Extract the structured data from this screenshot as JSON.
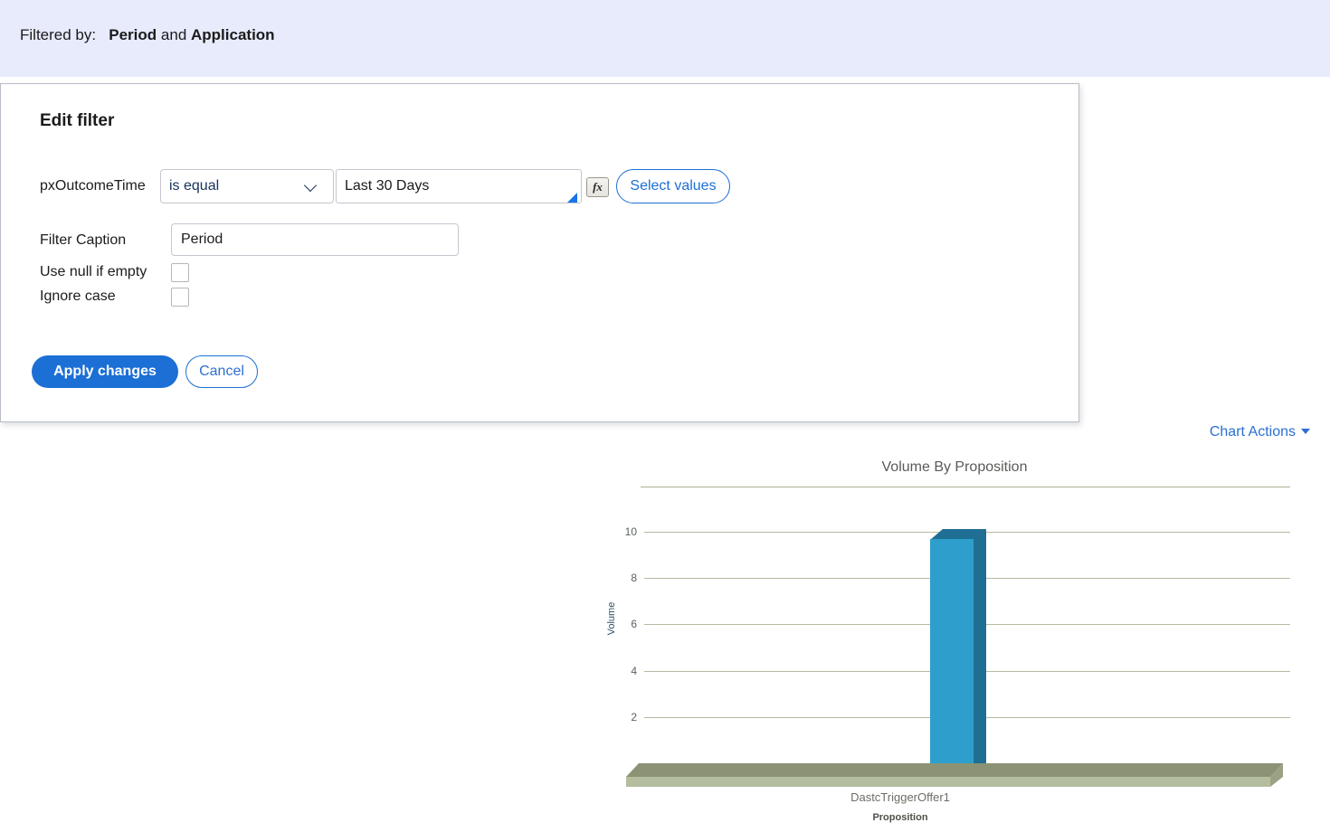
{
  "banner": {
    "prefix": "Filtered by:",
    "filter_one": "Period",
    "conjunction": "and",
    "filter_two": "Application"
  },
  "panel": {
    "title": "Edit filter",
    "property_label": "pxOutcomeTime",
    "operator_value": "is equal",
    "operator_options": [
      "is equal"
    ],
    "value_text": "Last 30 Days",
    "fx_label": "fx",
    "select_values_label": "Select values",
    "caption_label": "Filter Caption",
    "caption_value": "Period",
    "use_null_label": "Use null if empty",
    "use_null_checked": false,
    "ignore_case_label": "Ignore case",
    "ignore_case_checked": false,
    "apply_label": "Apply changes",
    "cancel_label": "Cancel"
  },
  "chart_actions": {
    "label": "Chart Actions"
  },
  "chart_data": {
    "type": "bar",
    "title": "Volume By Proposition",
    "categories": [
      "DastcTriggerOffer1"
    ],
    "values": [
      10
    ],
    "xlabel": "Proposition",
    "ylabel": "Volume",
    "ylim": [
      0,
      10
    ],
    "yticks": [
      10,
      8,
      6,
      4,
      2
    ],
    "grid": true,
    "legend": "none",
    "bar_color": "#2e9fcc",
    "bar_shade_color": "#1f6f94",
    "grid_color": "#b3baa0",
    "floor_color": "#8b9374"
  }
}
